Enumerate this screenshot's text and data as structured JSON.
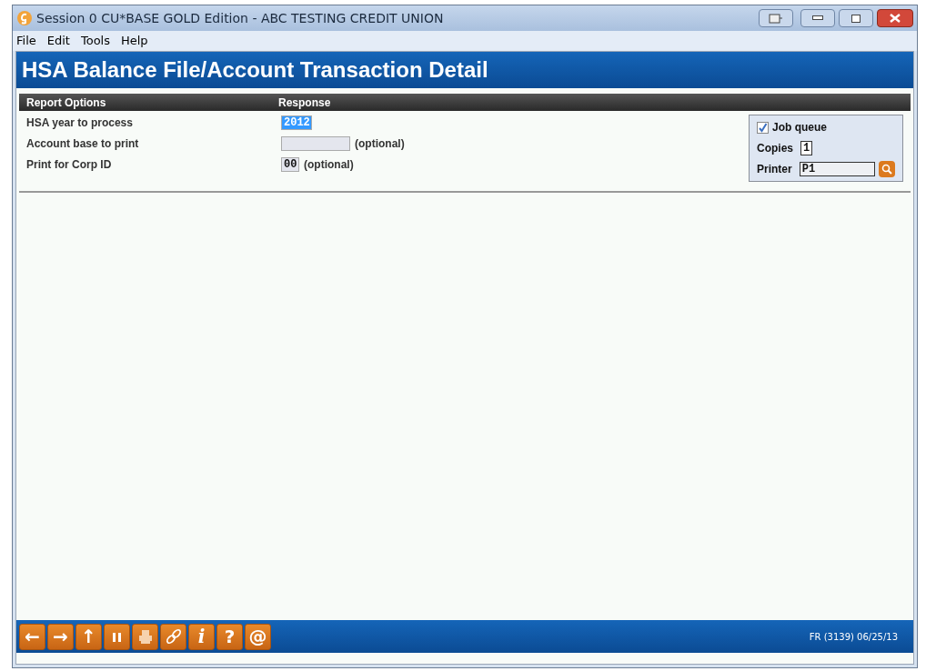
{
  "window": {
    "title": "Session 0 CU*BASE GOLD Edition - ABC TESTING CREDIT UNION"
  },
  "menu": [
    "File",
    "Edit",
    "Tools",
    "Help"
  ],
  "page_title": "HSA Balance File/Account Transaction Detail",
  "table": {
    "columns": [
      "Report Options",
      "Response"
    ],
    "rows": [
      {
        "label": "HSA year to process",
        "value": "2012",
        "selected": true
      },
      {
        "label": "Account base to print",
        "note": "(optional)",
        "selected": false
      },
      {
        "label": "Print for Corp ID",
        "value": "00",
        "note": "(optional)",
        "selected": false
      }
    ]
  },
  "print_options": {
    "job_queue": {
      "label": "Job queue",
      "checked": true
    },
    "copies": {
      "label": "Copies",
      "value": "1"
    },
    "printer": {
      "label": "Printer",
      "value": "P1"
    }
  },
  "toolbar": [
    {
      "kind": "glyph",
      "label": "←"
    },
    {
      "kind": "glyph",
      "label": "→"
    },
    {
      "kind": "glyph",
      "label": "↑"
    },
    {
      "kind": "pause"
    },
    {
      "kind": "printer"
    },
    {
      "kind": "link"
    },
    {
      "kind": "italic",
      "label": "i"
    },
    {
      "kind": "glyph",
      "label": "?"
    },
    {
      "kind": "glyph",
      "label": "@"
    }
  ],
  "status_bar": "FR (3139) 06/25/13"
}
